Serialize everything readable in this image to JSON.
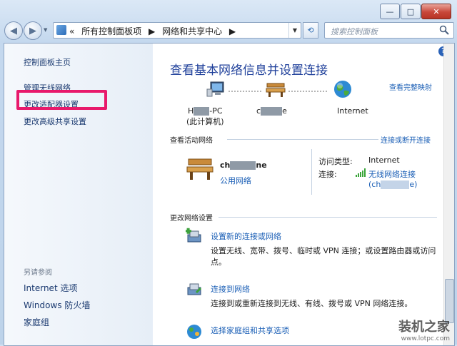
{
  "window": {
    "minimize_glyph": "—",
    "maximize_glyph": "□",
    "close_glyph": "✕"
  },
  "nav": {
    "back_glyph": "◀",
    "forward_glyph": "▶",
    "address_chevron": "«",
    "breadcrumb": [
      "所有控制面板项",
      "网络和共享中心"
    ],
    "breadcrumb_sep": "▶",
    "search_placeholder": "搜索控制面板"
  },
  "sidebar": {
    "home": "控制面板主页",
    "items": [
      "管理无线网络",
      "更改适配器设置",
      "更改高级共享设置"
    ],
    "see_also_title": "另请参阅",
    "see_also": [
      "Internet 选项",
      "Windows 防火墙",
      "家庭组"
    ]
  },
  "main": {
    "help_glyph": "?",
    "title": "查看基本网络信息并设置连接",
    "full_map_link": "查看完整映射",
    "map_nodes": [
      {
        "label_a": "H",
        "label_b": "-PC",
        "sub": "(此计算机)"
      },
      {
        "label_a": "c",
        "label_b": "e",
        "sub": ""
      },
      {
        "label": "Internet"
      }
    ],
    "active_title": "查看活动网络",
    "connect_link": "连接或断开连接",
    "active": {
      "name_a": "ch",
      "name_b": "ne",
      "type": "公用网络",
      "access_label": "访问类型:",
      "access_value": "Internet",
      "conn_label": "连接:",
      "conn_value": "无线网络连接",
      "conn_sub_a": "(ch",
      "conn_sub_b": "e)"
    },
    "change_title": "更改网络设置",
    "tasks": [
      {
        "title": "设置新的连接或网络",
        "desc1": "设置无线、宽带、拨号、临时或 VPN 连接；或设置路由器或访问",
        "desc2": "点。"
      },
      {
        "title": "连接到网络",
        "desc1": "连接到或重新连接到无线、有线、拨号或 VPN 网络连接。",
        "desc2": ""
      },
      {
        "title": "选择家庭组和共享选项",
        "desc1": "",
        "desc2": ""
      }
    ]
  },
  "watermark": {
    "text": "装机之家",
    "url": "www.lotpc.com"
  },
  "colors": {
    "link": "#1b5fb6",
    "title": "#1e3f9a",
    "highlight": "#e8196b"
  }
}
